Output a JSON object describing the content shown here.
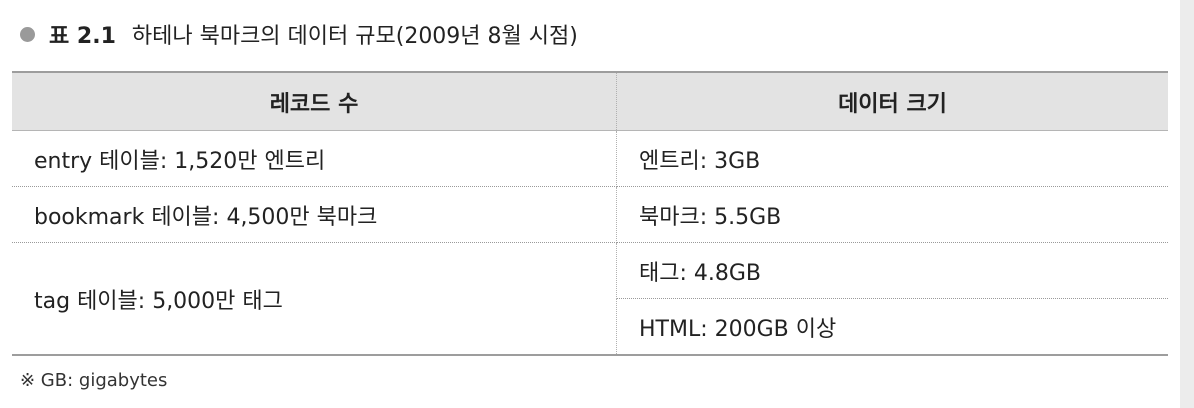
{
  "caption": {
    "label": "표 2.1",
    "title": "하테나 북마크의 데이터 규모(2009년 8월 시점)"
  },
  "table": {
    "headers": [
      "레코드 수",
      "데이터 크기"
    ],
    "rows": [
      {
        "records": "entry 테이블: 1,520만 엔트리",
        "sizes": [
          "엔트리: 3GB"
        ]
      },
      {
        "records": "bookmark 테이블: 4,500만 북마크",
        "sizes": [
          "북마크: 5.5GB"
        ]
      },
      {
        "records": "tag 테이블: 5,000만 태그",
        "sizes": [
          "태그: 4.8GB",
          "HTML: 200GB 이상"
        ]
      }
    ]
  },
  "note": "※ GB: gigabytes",
  "colors": {
    "header_bg": "#e3e3e3",
    "rule": "#9d9d9d",
    "bullet": "#9a9a9a"
  }
}
